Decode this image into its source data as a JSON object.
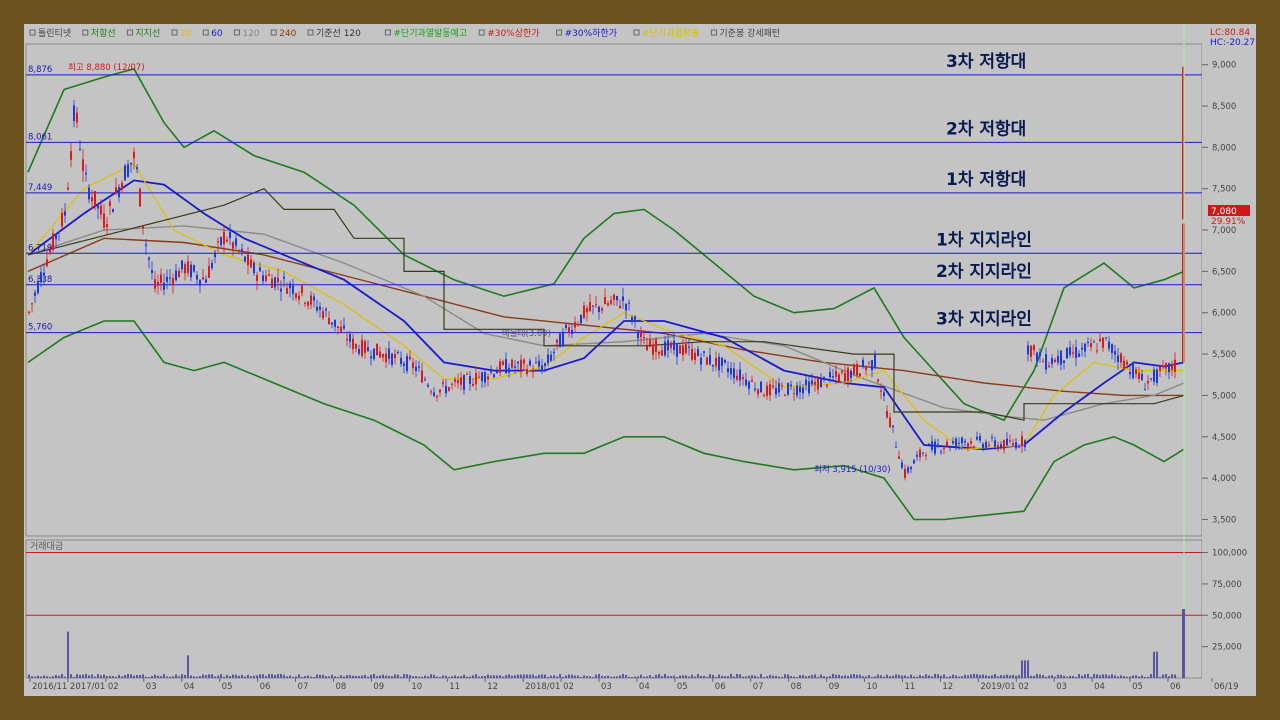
{
  "legend": {
    "items": [
      {
        "label": "틀린티넷",
        "color": "#444444"
      },
      {
        "label": "저항선",
        "color": "#1d7a1d"
      },
      {
        "label": "지지선",
        "color": "#1d7a1d"
      },
      {
        "label": "20",
        "color": "#e0c000"
      },
      {
        "label": "60",
        "color": "#1a1acc"
      },
      {
        "label": "120",
        "color": "#888888"
      },
      {
        "label": "240",
        "color": "#8b3a1a"
      },
      {
        "label": "기준선 120",
        "color": "#333333"
      },
      {
        "label": "#단기과열발동예고",
        "color": "#1aa01a"
      },
      {
        "label": "#30%상한가",
        "color": "#cc1a1a"
      },
      {
        "label": "#30%하한가",
        "color": "#1a1acc"
      },
      {
        "label": "#단기과열락출",
        "color": "#d9c000"
      },
      {
        "label": "기준봉 강세패턴",
        "color": "#444444"
      }
    ]
  },
  "indicators": {
    "lc": "LC:80.84",
    "hc": "HC:-20.27"
  },
  "price": {
    "last": "7,080",
    "change": "29.91%"
  },
  "volume_panel": {
    "title": "거래대금"
  },
  "chart_data": {
    "type": "line",
    "price_axis": {
      "range": [
        3300,
        9250
      ],
      "ticks": [
        "9,000",
        "8,500",
        "8,000",
        "7,500",
        "7,000",
        "6,500",
        "6,000",
        "5,500",
        "5,000",
        "4,500",
        "4,000",
        "3,500"
      ]
    },
    "volume_axis": {
      "range": [
        0,
        110000
      ],
      "ticks": [
        "100,000",
        "75,000",
        "50,000",
        "25,000"
      ]
    },
    "x_axis": {
      "labels": [
        "2016/11",
        "2017/01",
        "02",
        "03",
        "04",
        "05",
        "06",
        "07",
        "08",
        "09",
        "10",
        "11",
        "12",
        "2018/01",
        "02",
        "03",
        "04",
        "05",
        "06",
        "07",
        "08",
        "09",
        "10",
        "11",
        "12",
        "2019/01",
        "02",
        "03",
        "04",
        "05",
        "06",
        "06/19"
      ]
    },
    "levels": [
      {
        "value": 8876,
        "label": "8,876",
        "note": "3차 저항대"
      },
      {
        "value": 8061,
        "label": "8,061",
        "note": "2차 저항대"
      },
      {
        "value": 7449,
        "label": "7,449",
        "note": "1차 저항대"
      },
      {
        "value": 6719,
        "label": "6,719",
        "note": "1차 지지라인"
      },
      {
        "value": 6338,
        "label": "6,338",
        "note": "2차 지지라인"
      },
      {
        "value": 5760,
        "label": "5,760",
        "note": "3차 지지라인"
      }
    ],
    "annotations": {
      "high": "최고 8,880 (12/07)",
      "low": "최저 3,915 (10/30)",
      "mid": "매물대(3.09)"
    },
    "volume_ref_lines": [
      100000,
      50000
    ]
  }
}
